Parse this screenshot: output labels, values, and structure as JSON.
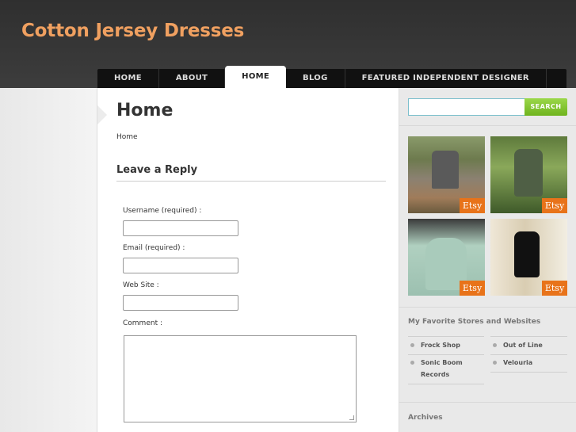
{
  "site": {
    "title": "Cotton Jersey Dresses"
  },
  "nav": {
    "items": [
      {
        "label": "HOME"
      },
      {
        "label": "ABOUT"
      },
      {
        "label": "HOME"
      },
      {
        "label": "BLOG"
      },
      {
        "label": "FEATURED INDEPENDENT DESIGNER"
      }
    ]
  },
  "main": {
    "title": "Home",
    "breadcrumb": "Home",
    "reply_heading": "Leave a Reply",
    "form": {
      "username_label": "Username (required) :",
      "email_label": "Email (required) :",
      "website_label": "Web Site :",
      "comment_label": "Comment :"
    }
  },
  "sidebar": {
    "search": {
      "button_label": "SEARCH"
    },
    "etsy_badge": "Etsy",
    "favorites_title": "My Favorite Stores and Websites",
    "links": [
      {
        "label": "Frock Shop"
      },
      {
        "label": "Out of Line"
      },
      {
        "label": "Sonic Boom Records"
      },
      {
        "label": "Velouria"
      }
    ],
    "archives_title": "Archives"
  },
  "colors": {
    "title_orange": "#f0a060",
    "search_green": "#7cc22a",
    "etsy_orange": "#e8731a"
  }
}
